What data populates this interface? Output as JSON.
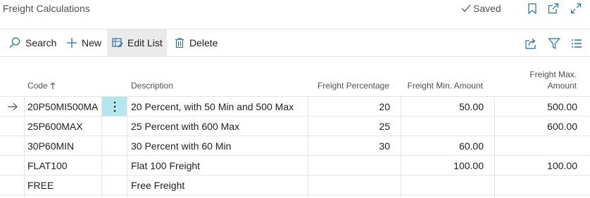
{
  "page": {
    "title": "Freight Calculations",
    "saved_label": "Saved"
  },
  "actions": {
    "search": "Search",
    "new": "New",
    "edit_list": "Edit List",
    "delete": "Delete"
  },
  "table": {
    "headers": {
      "code": "Code",
      "description": "Description",
      "freight_percentage": "Freight Percentage",
      "freight_min_amount": "Freight Min. Amount",
      "freight_max_amount_line1": "Freight Max.",
      "freight_max_amount_line2": "Amount"
    },
    "rows": [
      {
        "code": "20P50MI500MA",
        "description": "20 Percent, with 50 Min and 500 Max",
        "pct": "20",
        "min": "50.00",
        "max": "500.00"
      },
      {
        "code": "25P600MAX",
        "description": "25 Percent with 600 Max",
        "pct": "25",
        "min": "",
        "max": "600.00"
      },
      {
        "code": "30P60MIN",
        "description": "30 Percent with 60 Min",
        "pct": "30",
        "min": "60.00",
        "max": ""
      },
      {
        "code": "FLAT100",
        "description": "Flat 100 Freight",
        "pct": "",
        "min": "100.00",
        "max": "100.00"
      },
      {
        "code": "FREE",
        "description": "Free Freight",
        "pct": "",
        "min": "",
        "max": ""
      }
    ]
  },
  "icons": {
    "saved": "checkmark-icon",
    "bookmark": "bookmark-icon",
    "popout": "open-new-window-icon",
    "expand": "expand-icon",
    "search": "search-icon",
    "new": "plus-icon",
    "edit_list": "edit-list-icon",
    "delete": "trash-icon",
    "share": "share-icon",
    "filter": "filter-icon",
    "list_view": "list-view-icon",
    "sort": "sort-ascending-icon",
    "current_row": "arrow-right-icon",
    "context_menu": "more-vertical-icon"
  },
  "colors": {
    "accent": "#1f6fa8",
    "selected_cell": "#b4e6ee",
    "active_action": "#eaeaea"
  }
}
